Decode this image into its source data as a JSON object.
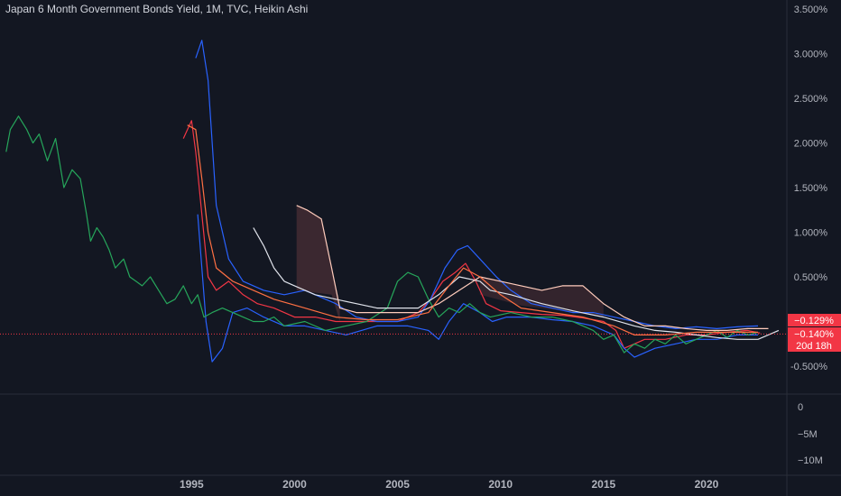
{
  "header": {
    "title": "Japan 6 Month Government Bonds Yield, 1M, TVC, Heikin Ashi"
  },
  "chart_data": {
    "type": "line",
    "title": "Japan 6 Month Government Bonds Yield, 1M, TVC, Heikin Ashi",
    "x_range": [
      1985.7,
      2023.9
    ],
    "ylim": [
      -0.75,
      3.6
    ],
    "y_ticks": [
      "3.500%",
      "3.000%",
      "2.500%",
      "2.000%",
      "1.500%",
      "1.000%",
      "0.500%",
      "-0.500%"
    ],
    "y_tick_values": [
      3.5,
      3.0,
      2.5,
      2.0,
      1.5,
      1.0,
      0.5,
      -0.5
    ],
    "x_ticks": [
      "1995",
      "2000",
      "2005",
      "2010",
      "2015",
      "2020"
    ],
    "x_tick_values": [
      1995,
      2000,
      2005,
      2010,
      2015,
      2020
    ],
    "volume_ticks": [
      "0",
      "−5M",
      "−10M"
    ],
    "price_tags": [
      {
        "label": "−0.129%",
        "color": "#f23645"
      },
      {
        "label": "−0.140%",
        "color": "#f23645"
      },
      {
        "label": "20d 18h",
        "color": "#f23645"
      }
    ],
    "current_value": -0.14,
    "grid": false,
    "series": [
      {
        "color": "#f23645",
        "x": [
          1994.6,
          1995.0,
          1995.2,
          1995.5,
          1995.8,
          1996.2,
          1996.8,
          1997.5,
          1998.2,
          1999.0,
          2000.0,
          2001.0,
          2002.0,
          2003.0,
          2004.0,
          2005.0,
          2006.0,
          2006.6,
          2007.2,
          2007.8,
          2008.3,
          2008.8,
          2009.3,
          2010.0,
          2011.0,
          2012.0,
          2013.0,
          2014.0,
          2015.0,
          2015.6,
          2016.0,
          2016.5,
          2017.0,
          2018.0,
          2019.0,
          2020.0,
          2021.0,
          2022.0,
          2022.6
        ],
        "y": [
          2.05,
          2.25,
          1.9,
          1.2,
          0.5,
          0.35,
          0.45,
          0.3,
          0.2,
          0.15,
          0.05,
          0.05,
          0.0,
          0.0,
          0.0,
          0.0,
          0.1,
          0.25,
          0.45,
          0.55,
          0.65,
          0.45,
          0.2,
          0.12,
          0.1,
          0.08,
          0.07,
          0.04,
          0.0,
          -0.1,
          -0.3,
          -0.25,
          -0.2,
          -0.2,
          -0.15,
          -0.15,
          -0.12,
          -0.1,
          -0.129
        ]
      },
      {
        "color": "#2962ff",
        "x": [
          1995.2,
          1995.5,
          1995.8,
          1996.2,
          1996.8,
          1997.5,
          1998.5,
          1999.5,
          2000.5,
          2002.0,
          2003.0,
          2004.0,
          2005.0,
          2006.0,
          2006.6,
          2007.3,
          2007.9,
          2008.4,
          2009.0,
          2009.8,
          2010.5,
          2011.5,
          2012.5,
          2013.5,
          2014.5,
          2015.5,
          2016.5,
          2017.5,
          2018.5,
          2019.5,
          2020.5,
          2021.5,
          2022.5
        ],
        "y": [
          2.95,
          3.15,
          2.7,
          1.3,
          0.7,
          0.45,
          0.35,
          0.3,
          0.35,
          0.2,
          0.05,
          0.0,
          0.0,
          0.05,
          0.25,
          0.6,
          0.8,
          0.85,
          0.7,
          0.5,
          0.35,
          0.2,
          0.15,
          0.1,
          0.1,
          0.05,
          0.0,
          -0.05,
          -0.08,
          -0.06,
          -0.08,
          -0.06,
          -0.05
        ]
      },
      {
        "color": "#2962ff",
        "x": [
          1995.3,
          1995.7,
          1996.0,
          1996.5,
          1997.0,
          1997.7,
          1998.5,
          1999.5,
          2000.5,
          2001.5,
          2002.5,
          2004.0,
          2005.5,
          2006.5,
          2007.0,
          2007.5,
          2008.2,
          2009.0,
          2009.6,
          2010.3,
          2011.5,
          2012.5,
          2013.5,
          2014.5,
          2015.5,
          2016.0,
          2016.5,
          2017.5,
          2018.5,
          2019.5,
          2020.5,
          2021.5,
          2022.5
        ],
        "y": [
          1.2,
          0.0,
          -0.45,
          -0.3,
          0.1,
          0.15,
          0.05,
          -0.05,
          -0.05,
          -0.1,
          -0.15,
          -0.05,
          -0.05,
          -0.1,
          -0.2,
          0.0,
          0.2,
          0.1,
          0.0,
          0.05,
          0.05,
          0.02,
          0.0,
          -0.05,
          -0.15,
          -0.3,
          -0.4,
          -0.3,
          -0.25,
          -0.2,
          -0.2,
          -0.15,
          -0.15
        ]
      },
      {
        "color": "#26a65b",
        "x": [
          1986.0,
          1986.2,
          1986.6,
          1987.0,
          1987.3,
          1987.6,
          1988.0,
          1988.4,
          1988.8,
          1989.2,
          1989.6,
          1989.9,
          1990.1,
          1990.4,
          1990.7,
          1991.0,
          1991.3,
          1991.7,
          1992.0,
          1992.3,
          1992.6,
          1993.0,
          1993.4,
          1993.8,
          1994.2,
          1994.6,
          1995.0,
          1995.3,
          1995.6,
          1996.0,
          1996.5,
          1997.0,
          1997.5,
          1998.0,
          1998.5,
          1999.0,
          1999.5,
          2000.5,
          2001.5,
          2002.5,
          2003.5,
          2004.5,
          2005.0,
          2005.5,
          2006.0,
          2006.5,
          2007.0,
          2007.5,
          2008.0,
          2008.5,
          2009.0,
          2009.5,
          2010.5,
          2011.5,
          2012.5,
          2013.5,
          2014.0,
          2014.5,
          2015.0,
          2015.5,
          2016.0,
          2016.5,
          2017.0,
          2017.5,
          2018.0,
          2018.5,
          2019.0,
          2019.5,
          2020.0,
          2020.5,
          2021.0,
          2021.5,
          2022.0,
          2022.5
        ],
        "y": [
          1.9,
          2.15,
          2.3,
          2.15,
          2.0,
          2.1,
          1.8,
          2.05,
          1.5,
          1.7,
          1.6,
          1.2,
          0.9,
          1.05,
          0.95,
          0.8,
          0.6,
          0.7,
          0.5,
          0.45,
          0.4,
          0.5,
          0.35,
          0.2,
          0.25,
          0.4,
          0.2,
          0.3,
          0.05,
          0.1,
          0.15,
          0.1,
          0.05,
          0.0,
          0.0,
          0.05,
          -0.05,
          0.0,
          -0.1,
          -0.05,
          0.0,
          0.15,
          0.45,
          0.55,
          0.5,
          0.25,
          0.05,
          0.15,
          0.1,
          0.2,
          0.1,
          0.05,
          0.1,
          0.05,
          0.05,
          0.0,
          -0.05,
          -0.1,
          -0.2,
          -0.15,
          -0.35,
          -0.25,
          -0.3,
          -0.2,
          -0.25,
          -0.15,
          -0.25,
          -0.2,
          -0.15,
          -0.1,
          -0.18,
          -0.1,
          -0.15,
          -0.12
        ]
      },
      {
        "color": "#e0e3eb",
        "x": [
          1998.0,
          1998.5,
          1999.0,
          1999.5,
          2000.0,
          2001.0,
          2002.0,
          2003.0,
          2004.0,
          2005.0,
          2006.0,
          2007.0,
          2008.0,
          2009.0,
          2009.5,
          2010.5,
          2012.0,
          2013.5,
          2015.0,
          2016.5,
          2017.5,
          2018.5,
          2019.5,
          2020.5,
          2021.5,
          2022.5,
          2023.5
        ],
        "y": [
          1.05,
          0.85,
          0.6,
          0.45,
          0.4,
          0.3,
          0.25,
          0.2,
          0.15,
          0.15,
          0.15,
          0.3,
          0.5,
          0.45,
          0.35,
          0.3,
          0.2,
          0.12,
          0.05,
          -0.05,
          -0.1,
          -0.12,
          -0.15,
          -0.18,
          -0.2,
          -0.2,
          -0.1
        ]
      },
      {
        "color": "#ffccbc",
        "x": [
          2000.1,
          2000.6,
          2001.3,
          2001.8,
          2002.2,
          2003.0,
          2004.0,
          2005.0,
          2006.0,
          2007.0,
          2008.0,
          2009.0,
          2010.0,
          2011.0,
          2012.0,
          2013.0,
          2014.0,
          2015.0,
          2016.0,
          2017.0,
          2018.0,
          2019.0,
          2020.0,
          2021.0,
          2022.0,
          2023.0
        ],
        "y": [
          1.3,
          1.25,
          1.15,
          0.6,
          0.15,
          0.1,
          0.1,
          0.1,
          0.1,
          0.2,
          0.35,
          0.5,
          0.45,
          0.4,
          0.35,
          0.4,
          0.4,
          0.2,
          0.05,
          -0.05,
          -0.05,
          -0.08,
          -0.1,
          -0.1,
          -0.08,
          -0.08
        ]
      },
      {
        "color": "#ff7043",
        "x": [
          1994.8,
          1995.2,
          1995.5,
          1995.8,
          1996.2,
          1997.0,
          1998.0,
          1999.0,
          2000.5,
          2002.0,
          2003.5,
          2005.0,
          2006.5,
          2007.5,
          2008.2,
          2009.0,
          2010.0,
          2011.0,
          2012.5,
          2014.0,
          2015.5,
          2016.5,
          2018.0,
          2019.5,
          2021.0,
          2022.5
        ],
        "y": [
          2.2,
          2.15,
          1.6,
          1.0,
          0.6,
          0.45,
          0.35,
          0.25,
          0.15,
          0.05,
          0.02,
          0.02,
          0.1,
          0.4,
          0.6,
          0.5,
          0.3,
          0.15,
          0.1,
          0.05,
          -0.05,
          -0.15,
          -0.15,
          -0.12,
          -0.12,
          -0.12
        ]
      }
    ]
  }
}
